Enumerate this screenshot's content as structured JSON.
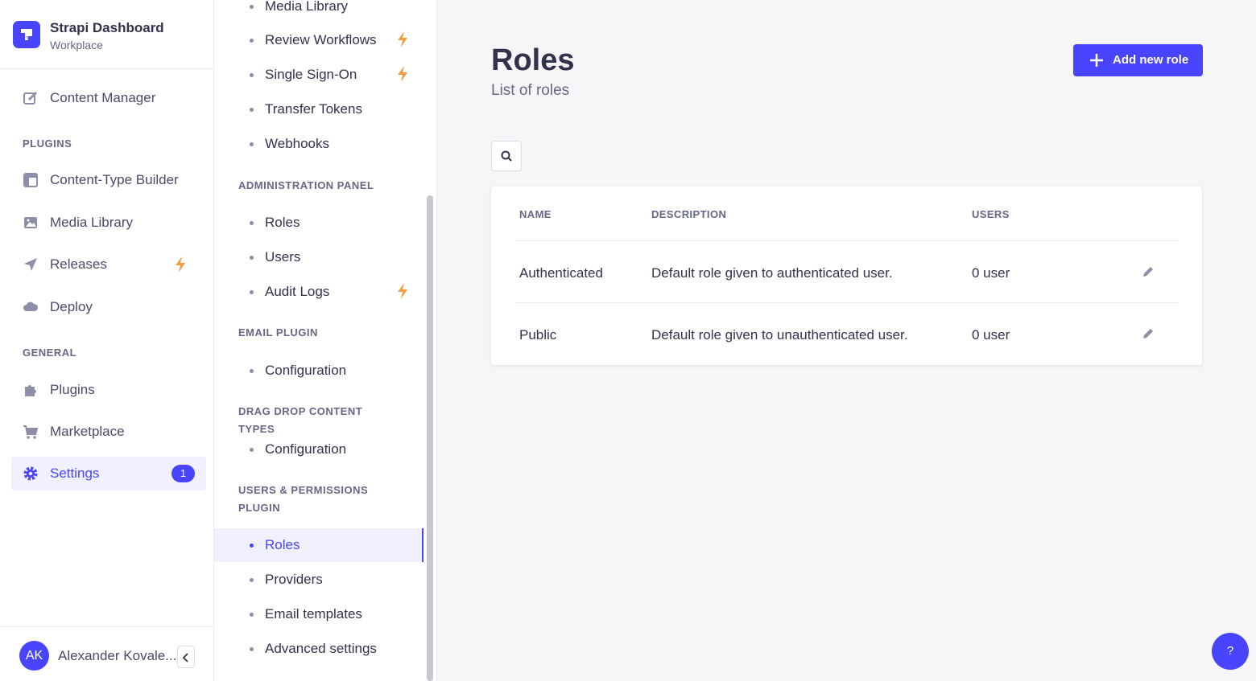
{
  "brand": {
    "title": "Strapi Dashboard",
    "subtitle": "Workplace"
  },
  "mainnav": {
    "content_manager": "Content Manager",
    "plugins_heading": "PLUGINS",
    "content_type_builder": "Content-Type Builder",
    "media_library": "Media Library",
    "releases": "Releases",
    "deploy": "Deploy",
    "general_heading": "GENERAL",
    "plugins": "Plugins",
    "marketplace": "Marketplace",
    "settings": "Settings",
    "settings_badge": "1"
  },
  "user": {
    "initials": "AK",
    "name": "Alexander Kovale..."
  },
  "subnav": {
    "media_library": "Media Library",
    "review_workflows": "Review Workflows",
    "single_sign_on": "Single Sign-On",
    "transfer_tokens": "Transfer Tokens",
    "webhooks": "Webhooks",
    "admin_panel_heading": "ADMINISTRATION PANEL",
    "admin_roles": "Roles",
    "admin_users": "Users",
    "audit_logs": "Audit Logs",
    "email_plugin_heading": "EMAIL PLUGIN",
    "email_configuration": "Configuration",
    "ddct_heading": "DRAG DROP CONTENT TYPES",
    "ddct_configuration": "Configuration",
    "up_heading_line1": "USERS & PERMISSIONS",
    "up_heading_line2": "PLUGIN",
    "up_roles": "Roles",
    "up_providers": "Providers",
    "up_email_templates": "Email templates",
    "up_advanced_settings": "Advanced settings"
  },
  "page": {
    "title": "Roles",
    "subtitle": "List of roles",
    "add_button": "Add new role"
  },
  "table": {
    "headers": {
      "name": "NAME",
      "description": "DESCRIPTION",
      "users": "USERS"
    },
    "rows": [
      {
        "name": "Authenticated",
        "description": "Default role given to authenticated user.",
        "users": "0 user"
      },
      {
        "name": "Public",
        "description": "Default role given to unauthenticated user.",
        "users": "0 user"
      }
    ]
  },
  "help": {
    "label": "?"
  },
  "colors": {
    "primary": "#4945ff",
    "bolt": "#f29d41",
    "active_bg": "#f0f0ff"
  }
}
